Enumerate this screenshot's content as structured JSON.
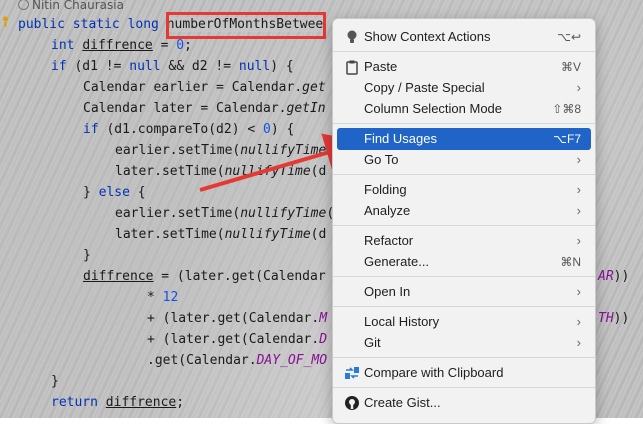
{
  "editor": {
    "author": "Nitin Chaurasia",
    "lines": [
      {
        "parts": [
          [
            "kw",
            "public static long "
          ],
          [
            "hl",
            "numberOfMonthsBetwee"
          ]
        ]
      },
      {
        "parts": [
          [
            "kw",
            "int "
          ],
          [
            "ul",
            "diffrence"
          ],
          [
            "t",
            " = "
          ],
          [
            "num",
            "0"
          ],
          [
            "t",
            ";"
          ]
        ]
      },
      {
        "parts": [
          [
            "kw",
            "if "
          ],
          [
            "t",
            "(d1 != "
          ],
          [
            "kw",
            "null "
          ],
          [
            "t",
            "&& d2 != "
          ],
          [
            "kw",
            "null"
          ],
          [
            "t",
            ") {"
          ]
        ]
      },
      {
        "parts": [
          [
            "t",
            "Calendar earlier = Calendar."
          ],
          [
            "it",
            "get"
          ]
        ]
      },
      {
        "parts": [
          [
            "t",
            "Calendar later = Calendar."
          ],
          [
            "it",
            "getIn"
          ]
        ]
      },
      {
        "parts": [
          [
            "kw",
            "if "
          ],
          [
            "t",
            "(d1.compareTo(d2) < "
          ],
          [
            "num",
            "0"
          ],
          [
            "t",
            ") {"
          ]
        ]
      },
      {
        "parts": [
          [
            "t",
            "earlier.setTime("
          ],
          [
            "it",
            "nullifyTime"
          ],
          [
            "t",
            "("
          ]
        ]
      },
      {
        "parts": [
          [
            "t",
            "later.setTime("
          ],
          [
            "it",
            "nullifyTime"
          ],
          [
            "t",
            "(d"
          ]
        ]
      },
      {
        "parts": [
          [
            "t",
            "} "
          ],
          [
            "kw",
            "else "
          ],
          [
            "t",
            "{"
          ]
        ]
      },
      {
        "parts": [
          [
            "t",
            "earlier.setTime("
          ],
          [
            "it",
            "nullifyTime"
          ],
          [
            "t",
            "("
          ]
        ]
      },
      {
        "parts": [
          [
            "t",
            "later.setTime("
          ],
          [
            "it",
            "nullifyTime"
          ],
          [
            "t",
            "(d"
          ]
        ]
      },
      {
        "parts": [
          [
            "t",
            "}"
          ]
        ]
      },
      {
        "parts": [
          [
            "ul",
            "diffrence"
          ],
          [
            "t",
            " = (later.get(Calendar"
          ]
        ]
      },
      {
        "parts": [
          [
            "t",
            "* "
          ],
          [
            "num",
            "12"
          ]
        ]
      },
      {
        "parts": [
          [
            "t",
            "+ (later.get(Calendar."
          ],
          [
            "pur",
            "M"
          ]
        ]
      },
      {
        "parts": [
          [
            "t",
            "+ (later.get(Calendar."
          ],
          [
            "pur",
            "D"
          ]
        ]
      },
      {
        "parts": [
          [
            "t",
            ".get(Calendar."
          ],
          [
            "pur",
            "DAY_OF_MO"
          ]
        ]
      },
      {
        "parts": [
          [
            "t",
            "}"
          ]
        ]
      },
      {
        "parts": [
          [
            "kw",
            "return "
          ],
          [
            "ul",
            "diffrence"
          ],
          [
            "t",
            ";"
          ]
        ]
      }
    ],
    "right_fragments": [
      {
        "line": 12,
        "text": "AR))"
      },
      {
        "line": 14,
        "text": "TH))"
      }
    ]
  },
  "menu": {
    "items": [
      {
        "label": "Show Context Actions",
        "shortcut": "⌥↩",
        "icon": "bulb-icon",
        "name": "menu-show-context-actions"
      },
      {
        "sep": true
      },
      {
        "label": "Paste",
        "shortcut": "⌘V",
        "icon": "clipboard-icon",
        "name": "menu-paste"
      },
      {
        "label": "Copy / Paste Special",
        "submenu": true,
        "name": "menu-copy-paste-special"
      },
      {
        "label": "Column Selection Mode",
        "shortcut": "⇧⌘8",
        "name": "menu-column-selection-mode"
      },
      {
        "sep": true
      },
      {
        "label": "Find Usages",
        "shortcut": "⌥F7",
        "selected": true,
        "name": "menu-find-usages"
      },
      {
        "label": "Go To",
        "submenu": true,
        "name": "menu-go-to"
      },
      {
        "sep": true
      },
      {
        "label": "Folding",
        "submenu": true,
        "name": "menu-folding"
      },
      {
        "label": "Analyze",
        "submenu": true,
        "name": "menu-analyze"
      },
      {
        "sep": true
      },
      {
        "label": "Refactor",
        "submenu": true,
        "name": "menu-refactor"
      },
      {
        "label": "Generate...",
        "shortcut": "⌘N",
        "name": "menu-generate"
      },
      {
        "sep": true
      },
      {
        "label": "Open In",
        "submenu": true,
        "name": "menu-open-in"
      },
      {
        "sep": true
      },
      {
        "label": "Local History",
        "submenu": true,
        "name": "menu-local-history"
      },
      {
        "label": "Git",
        "submenu": true,
        "name": "menu-git"
      },
      {
        "sep": true
      },
      {
        "label": "Compare with Clipboard",
        "icon": "compare-icon",
        "name": "menu-compare-with-clipboard"
      },
      {
        "sep": true
      },
      {
        "label": "Create Gist...",
        "icon": "github-icon",
        "name": "menu-create-gist"
      }
    ]
  },
  "colors": {
    "selection": "#2064c8",
    "annotation_red": "#e53935",
    "keyword": "#0033b3"
  }
}
